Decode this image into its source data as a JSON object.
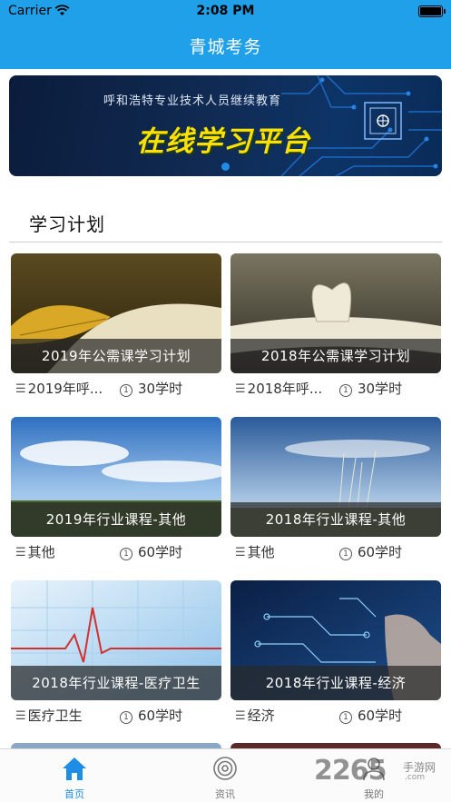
{
  "status_bar": {
    "carrier": "Carrier",
    "time": "2:08 PM"
  },
  "header": {
    "title": "青城考务"
  },
  "banner": {
    "subtitle": "呼和浩特专业技术人员继续教育",
    "headline": "在线学习平台",
    "accent_color": "#ffe100"
  },
  "section": {
    "title": "学习计划"
  },
  "plans": [
    {
      "caption": "2019年公需课学习计划",
      "category": "2019年呼...",
      "hours": "30学时",
      "image": "autumn-leaf-on-book"
    },
    {
      "caption": "2018年公需课学习计划",
      "category": "2018年呼...",
      "hours": "30学时",
      "image": "open-book-heart-pages"
    },
    {
      "caption": "2019年行业课程-其他",
      "category": "其他",
      "hours": "60学时",
      "image": "sky-and-field"
    },
    {
      "caption": "2018年行业课程-其他",
      "category": "其他",
      "hours": "60学时",
      "image": "grass-and-sky"
    },
    {
      "caption": "2018年行业课程-医疗卫生",
      "category": "医疗卫生",
      "hours": "60学时",
      "image": "heartbeat-line"
    },
    {
      "caption": "2018年行业课程-经济",
      "category": "经济",
      "hours": "60学时",
      "image": "tech-circuit-hand"
    }
  ],
  "tabbar": {
    "tabs": [
      {
        "label": "首页",
        "icon": "home-icon",
        "active": true
      },
      {
        "label": "资讯",
        "icon": "news-icon",
        "active": false
      },
      {
        "label": "我的",
        "icon": "user-icon",
        "active": false
      }
    ]
  },
  "watermark": {
    "brand": "2265",
    "site": "手游网",
    "url": ".com"
  },
  "colors": {
    "primary": "#1fa0e8",
    "tab_active": "#1e8ee5"
  }
}
